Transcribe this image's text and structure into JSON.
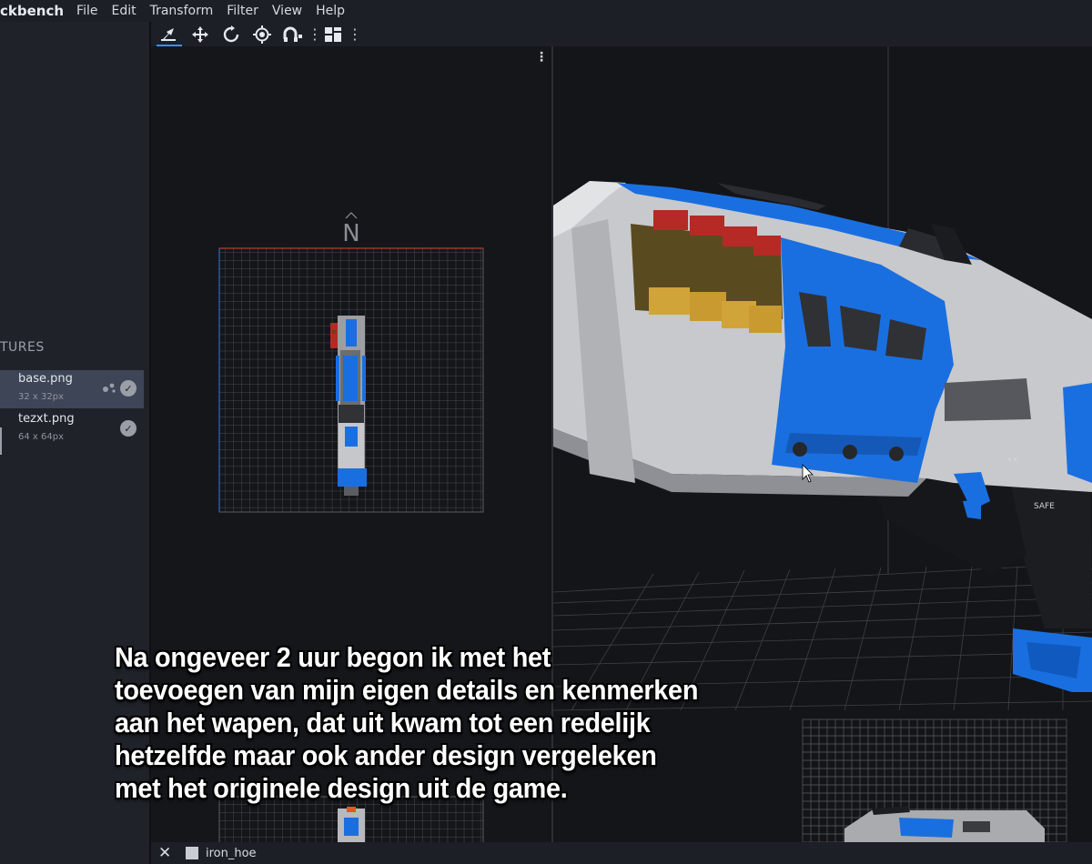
{
  "app": {
    "title": "ckbench"
  },
  "menu": [
    "File",
    "Edit",
    "Transform",
    "Filter",
    "View",
    "Help"
  ],
  "toolbar": {
    "tools": [
      "move-uv-tool",
      "translate-tool",
      "rotate-tool",
      "pivot-tool",
      "vertex-snap-tool"
    ],
    "more": "⋮",
    "tools2": [
      "layout-tool"
    ]
  },
  "sidebar": {
    "panel_title": "TURES",
    "textures": [
      {
        "name": "base.png",
        "size": "32 x 32px",
        "selected": true
      },
      {
        "name": "tezxt.png",
        "size": "64 x 64px",
        "selected": false
      }
    ]
  },
  "uv_editor": {
    "compass": "N",
    "grid_color": "#5a5c64",
    "accent_top": "#c0392b",
    "accent_left": "#2e5bd9"
  },
  "status": {
    "project": "iron_hoe"
  },
  "caption": {
    "lines": [
      "Na ongeveer 2 uur begon ik met het",
      "toevoegen van mijn eigen details en kenmerken",
      "aan het wapen, dat uit kwam tot een redelijk",
      "hetzelfde maar ook ander design vergeleken",
      "met het originele design uit de game."
    ]
  },
  "model": {
    "engraving": "SAFE",
    "primary_color": "#1a6fe0",
    "body_color": "#cfcfd2",
    "shell_color": "#c9a53a",
    "tip_color": "#b32a24"
  }
}
